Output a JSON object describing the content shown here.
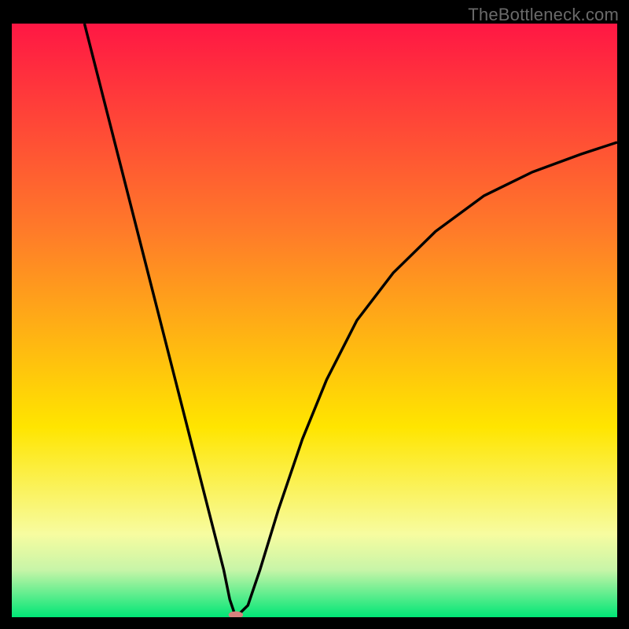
{
  "watermark": "TheBottleneck.com",
  "chart_data": {
    "type": "line",
    "title": "",
    "xlabel": "",
    "ylabel": "",
    "xlim": [
      0,
      100
    ],
    "ylim": [
      0,
      100
    ],
    "curve": {
      "name": "bottleneck-curve",
      "minimum_x": 37,
      "points": [
        {
          "x": 12,
          "y": 100
        },
        {
          "x": 15,
          "y": 88
        },
        {
          "x": 18,
          "y": 76
        },
        {
          "x": 21,
          "y": 64
        },
        {
          "x": 24,
          "y": 52
        },
        {
          "x": 27,
          "y": 40
        },
        {
          "x": 30,
          "y": 28
        },
        {
          "x": 33,
          "y": 16
        },
        {
          "x": 35,
          "y": 8
        },
        {
          "x": 36,
          "y": 3
        },
        {
          "x": 37,
          "y": 0
        },
        {
          "x": 39,
          "y": 2
        },
        {
          "x": 41,
          "y": 8
        },
        {
          "x": 44,
          "y": 18
        },
        {
          "x": 48,
          "y": 30
        },
        {
          "x": 52,
          "y": 40
        },
        {
          "x": 57,
          "y": 50
        },
        {
          "x": 63,
          "y": 58
        },
        {
          "x": 70,
          "y": 65
        },
        {
          "x": 78,
          "y": 71
        },
        {
          "x": 86,
          "y": 75
        },
        {
          "x": 94,
          "y": 78
        },
        {
          "x": 100,
          "y": 80
        }
      ]
    },
    "marker": {
      "x": 37,
      "y": 0,
      "rx": 1.2,
      "ry": 0.6,
      "color": "#d9827e"
    },
    "background_gradient": {
      "top_color": "#ff1744",
      "mid1_color": "#ff7b29",
      "mid2_color": "#ffe500",
      "low1_color": "#f7fca0",
      "low2_color": "#c8f5a8",
      "bottom_color": "#00e676",
      "stops": [
        0,
        0.35,
        0.68,
        0.86,
        0.92,
        1.0
      ]
    }
  }
}
